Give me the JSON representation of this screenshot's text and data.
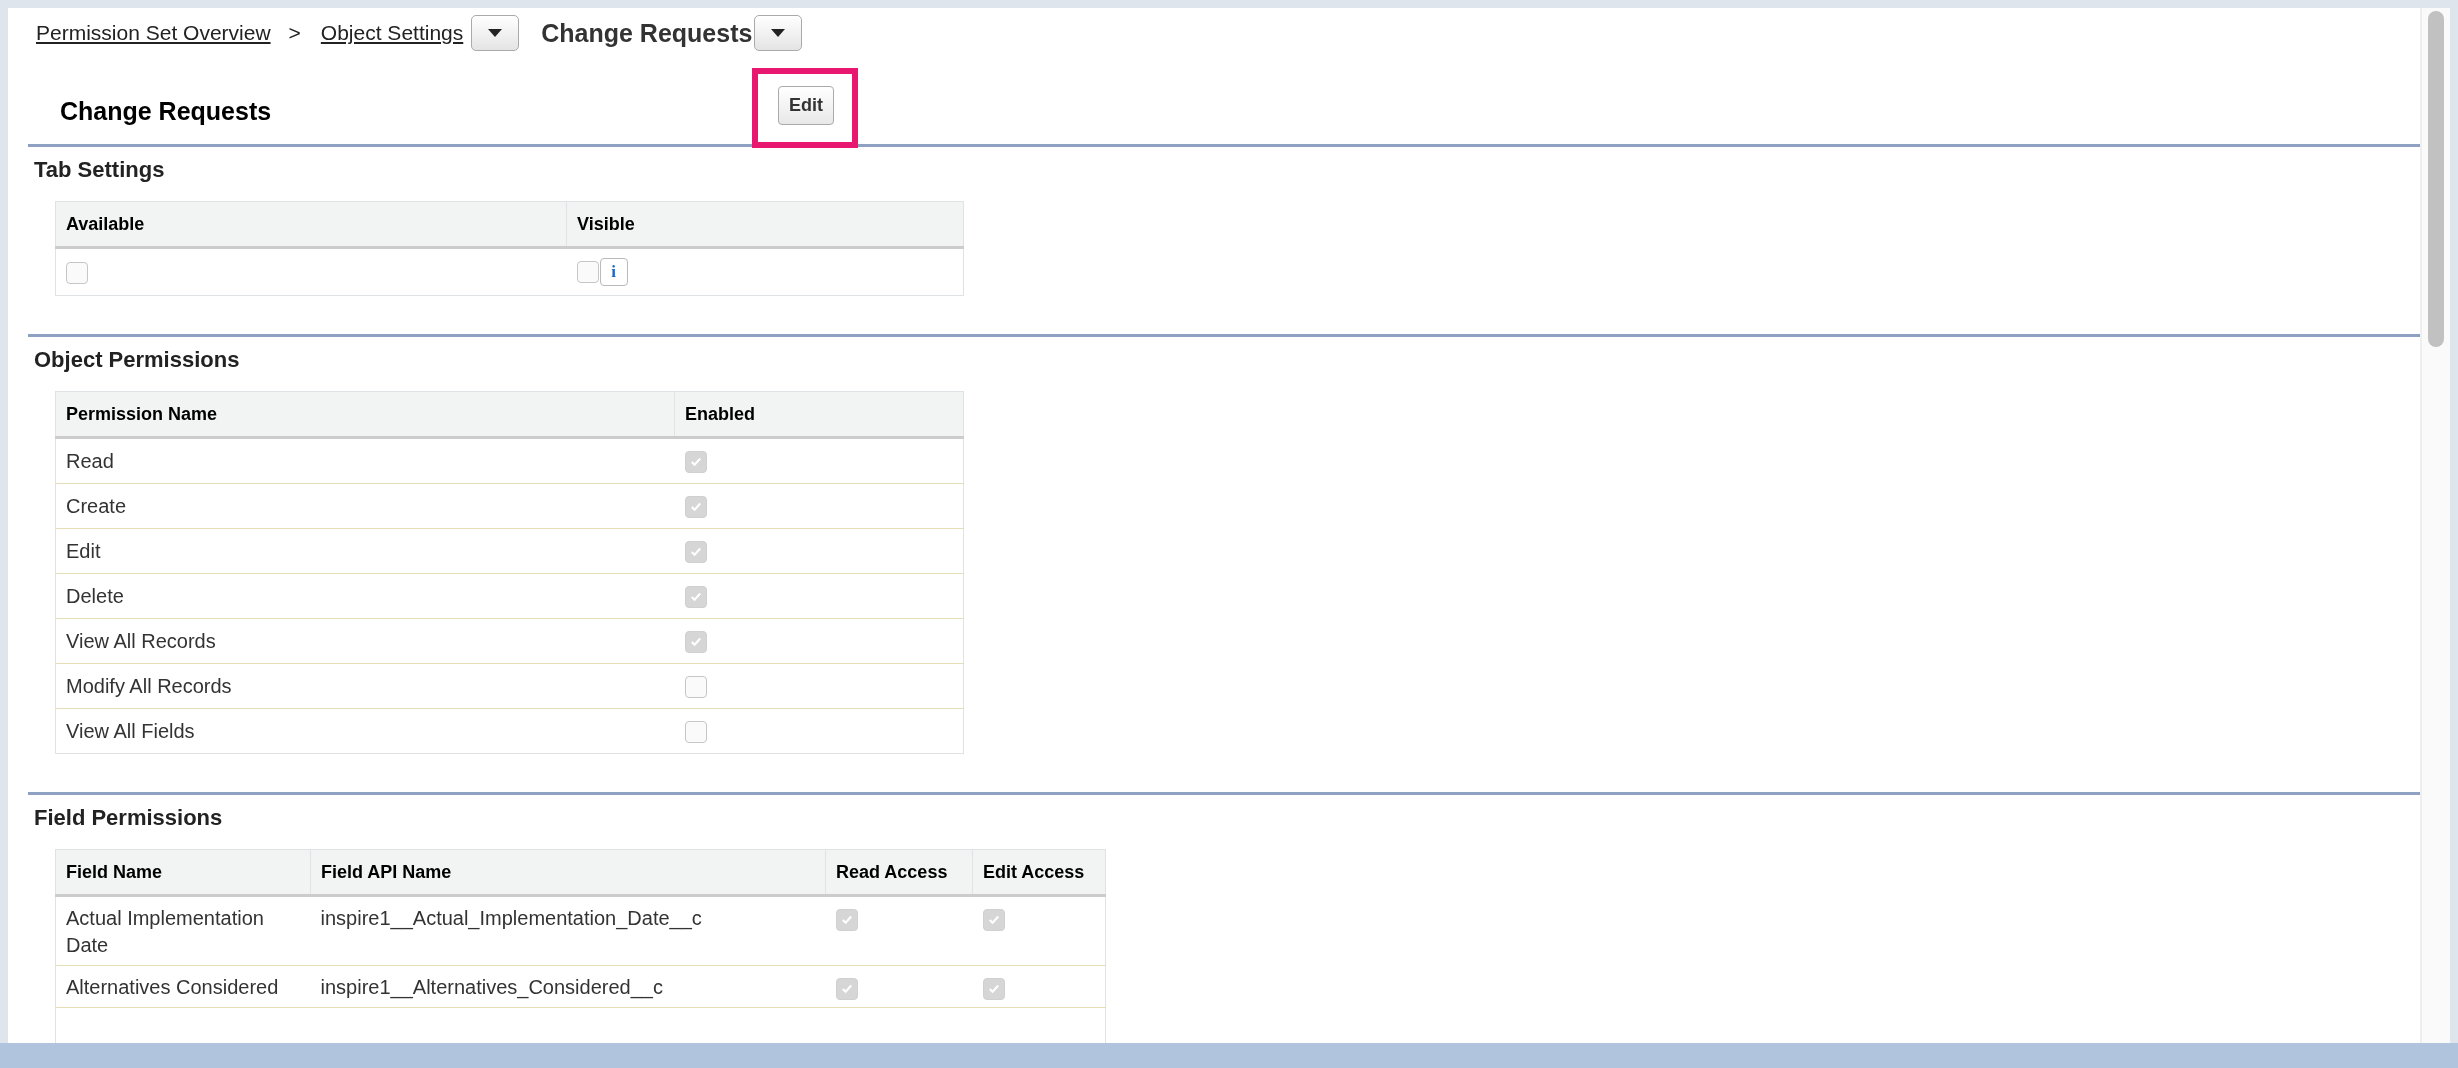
{
  "breadcrumb": {
    "links": [
      {
        "label": "Permission Set Overview",
        "has_menu": false
      },
      {
        "label": "Object Settings",
        "has_menu": true
      }
    ],
    "separator": ">",
    "current": {
      "label": "Change Requests",
      "has_menu": true
    }
  },
  "header": {
    "title": "Change Requests",
    "edit_button": "Edit",
    "edit_highlighted": true
  },
  "tab_settings": {
    "title": "Tab Settings",
    "columns": [
      "Available",
      "Visible"
    ],
    "row": {
      "available": false,
      "visible": false,
      "visible_info": "i"
    }
  },
  "object_permissions": {
    "title": "Object Permissions",
    "columns": [
      "Permission Name",
      "Enabled"
    ],
    "rows": [
      {
        "name": "Read",
        "enabled": true
      },
      {
        "name": "Create",
        "enabled": true
      },
      {
        "name": "Edit",
        "enabled": true
      },
      {
        "name": "Delete",
        "enabled": true
      },
      {
        "name": "View All Records",
        "enabled": true
      },
      {
        "name": "Modify All Records",
        "enabled": false
      },
      {
        "name": "View All Fields",
        "enabled": false
      }
    ]
  },
  "field_permissions": {
    "title": "Field Permissions",
    "columns": [
      "Field Name",
      "Field API Name",
      "Read Access",
      "Edit Access"
    ],
    "rows": [
      {
        "name": "Actual Implementation Date",
        "api_name": "inspire1__Actual_Implementation_Date__c",
        "read": true,
        "edit": true
      },
      {
        "name": "Alternatives Considered",
        "api_name": "inspire1__Alternatives_Considered__c",
        "read": true,
        "edit": true
      }
    ]
  }
}
